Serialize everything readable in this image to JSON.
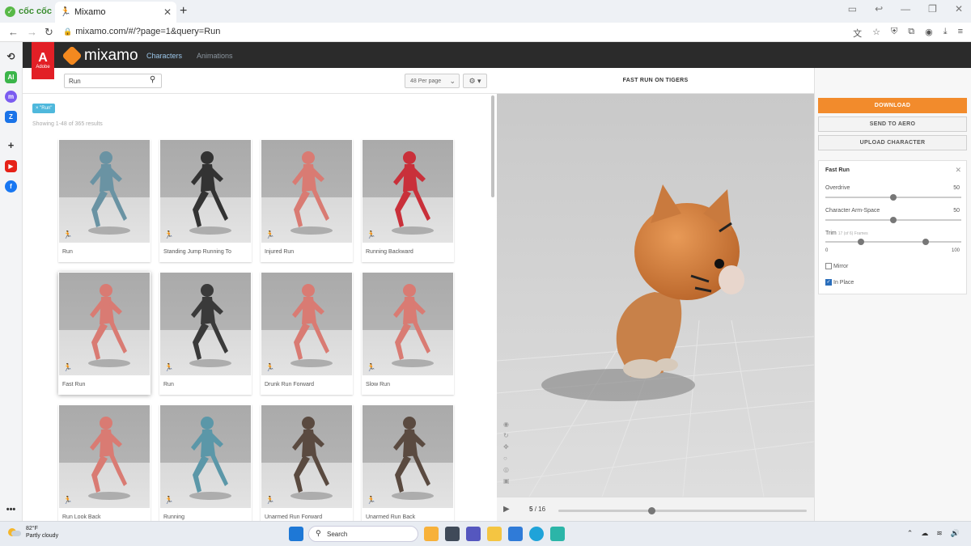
{
  "browser": {
    "brand": "cốc cốc",
    "tab_title": "Mixamo",
    "url": "mixamo.com/#/?page=1&query=Run"
  },
  "mixamo": {
    "adobe_label": "Adobe",
    "logo_text": "mixamo",
    "nav": [
      "Characters",
      "Animations"
    ],
    "search_value": "Run",
    "per_page": "48 Per page",
    "filter_chip": "× \"Run\"",
    "results_text": "Showing 1-48 of 365 results",
    "cards": [
      {
        "name": "Run",
        "color": "#6a93a3"
      },
      {
        "name": "Standing Jump Running To",
        "color": "#333333"
      },
      {
        "name": "Injured Run",
        "color": "#d97b73"
      },
      {
        "name": "Running Backward",
        "color": "#c9303a"
      },
      {
        "name": "Fast Run",
        "color": "#d97b73"
      },
      {
        "name": "Run",
        "color": "#3a3a3a"
      },
      {
        "name": "Drunk Run Forward",
        "color": "#d97b73"
      },
      {
        "name": "Slow Run",
        "color": "#d97b73"
      },
      {
        "name": "Run Look Back",
        "color": "#d97b73"
      },
      {
        "name": "Running",
        "color": "#5b97a8"
      },
      {
        "name": "Unarmed Run Forward",
        "color": "#5a4a40"
      },
      {
        "name": "Unarmed Run Back",
        "color": "#5a4a40"
      }
    ],
    "selected_index": 4,
    "viewer_title": "FAST RUN ON TIGERS",
    "frame_current": "5",
    "frame_total": "/ 16",
    "timeline_progress": 0.37,
    "buttons": {
      "download": "DOWNLOAD",
      "send": "SEND TO AERO",
      "upload": "UPLOAD CHARACTER"
    },
    "settings": {
      "title": "Fast Run",
      "overdrive_label": "Overdrive",
      "overdrive_value": "50",
      "armspace_label": "Character Arm-Space",
      "armspace_value": "50",
      "trim_label": "Trim",
      "trim_note": "17 (of 6) Frames",
      "trim_min": "0",
      "trim_max": "100",
      "mirror_label": "Mirror",
      "mirror_checked": false,
      "inplace_label": "In Place",
      "inplace_checked": true
    }
  },
  "taskbar": {
    "temp": "82°F",
    "weather": "Partly cloudy",
    "search_placeholder": "Search"
  },
  "colors": {
    "accent": "#f28b2c",
    "chip": "#4fb8dc",
    "header": "#2b2b2b",
    "adobe": "#e21f26"
  }
}
